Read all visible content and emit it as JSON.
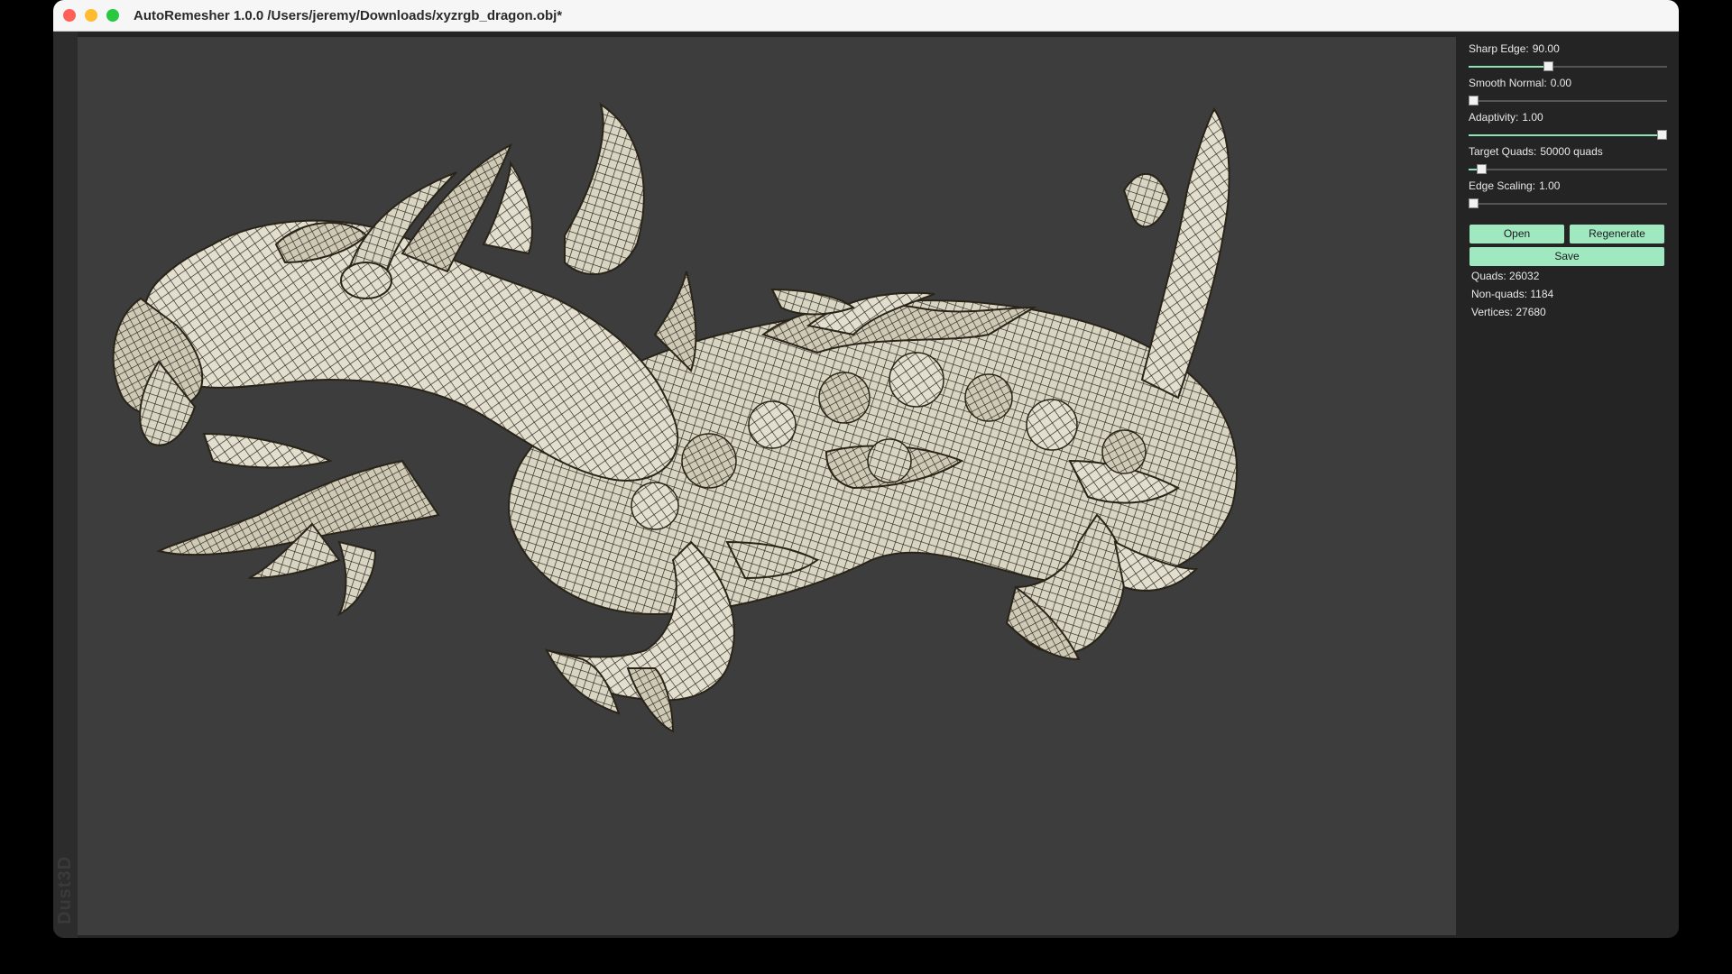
{
  "window": {
    "title": "AutoRemesher 1.0.0 /Users/jeremy/Downloads/xyzrgb_dragon.obj*",
    "watermark": "Dust3D"
  },
  "colors": {
    "accent": "#a0e8c0",
    "viewport_bg": "#3d3d3d",
    "panel_bg": "#242424",
    "mesh_fill": "#d8d4c0",
    "mesh_line": "#1e1a14"
  },
  "params": [
    {
      "label": "Sharp Edge:",
      "value": "90.00",
      "fraction": 0.4
    },
    {
      "label": "Smooth Normal:",
      "value": "0.00",
      "fraction": 0.0
    },
    {
      "label": "Adaptivity:",
      "value": "1.00",
      "fraction": 1.0
    },
    {
      "label": "Target Quads:",
      "value": "50000 quads",
      "fraction": 0.04
    },
    {
      "label": "Edge Scaling:",
      "value": "1.00",
      "fraction": 0.0
    }
  ],
  "buttons": {
    "open": "Open",
    "regenerate": "Regenerate",
    "save": "Save"
  },
  "stats": {
    "quads": "Quads: 26032",
    "non_quads": "Non-quads: 1184",
    "vertices": "Vertices: 27680"
  },
  "viewport": {
    "model_name": "xyzrgb_dragon"
  }
}
